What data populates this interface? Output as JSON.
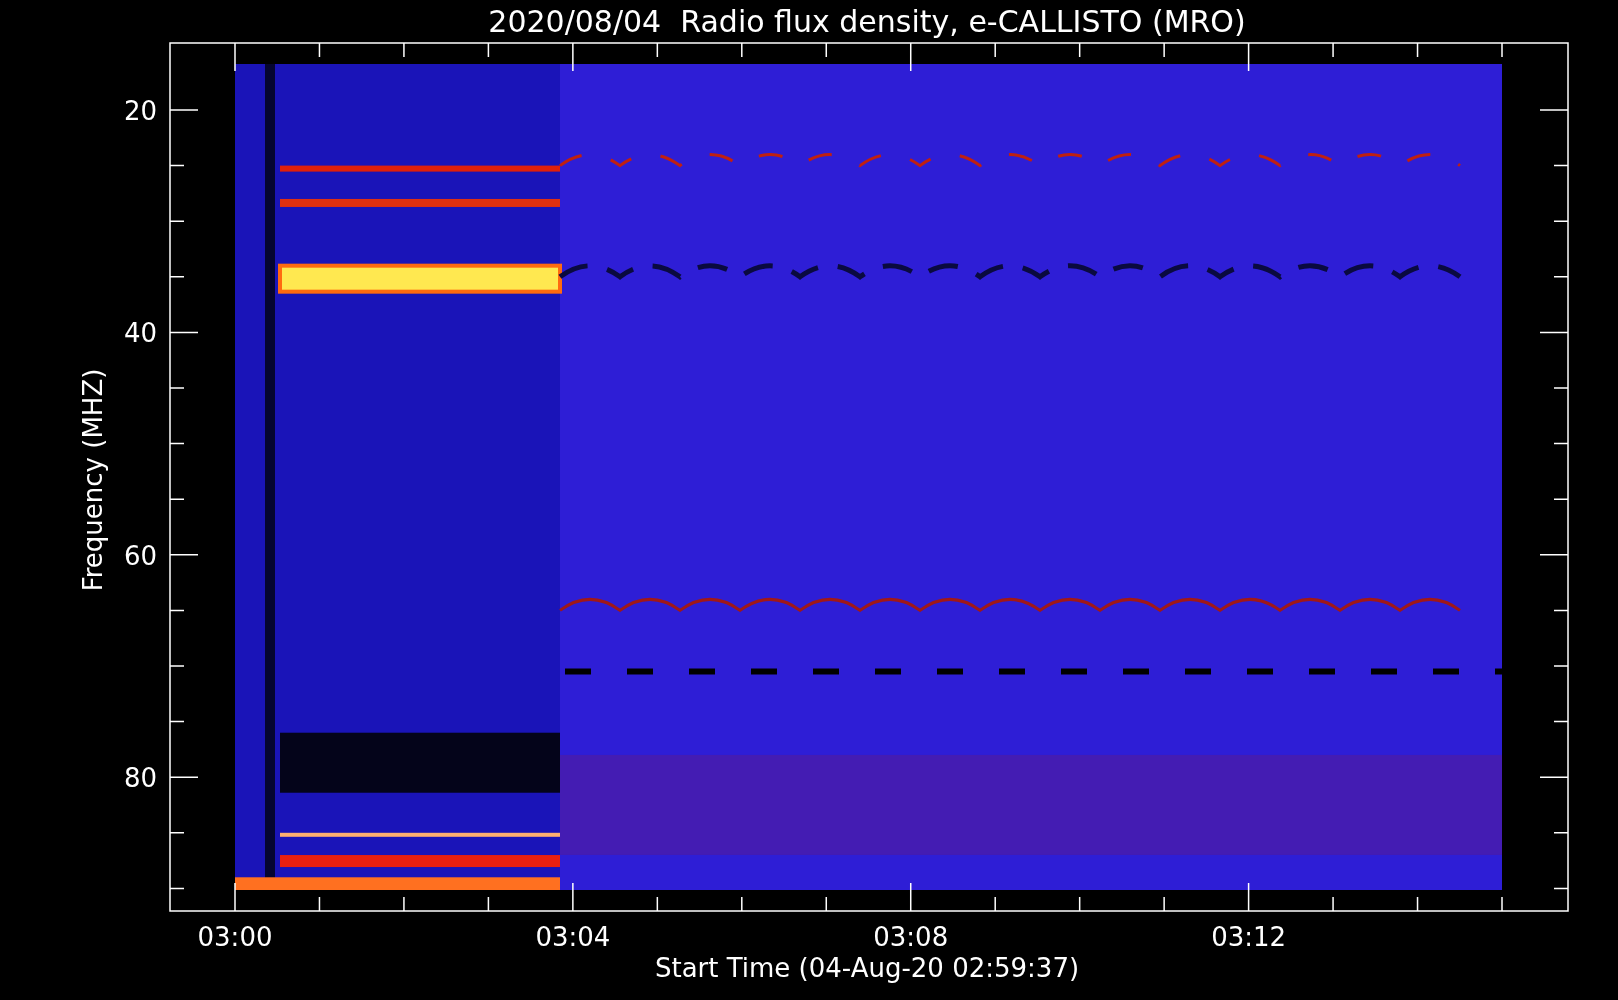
{
  "title": "2020/08/04  Radio flux density, e-CALLISTO (MRO)",
  "y_axis": {
    "label": "Frequency (MHZ)",
    "ticks": [
      "20",
      "40",
      "60",
      "80"
    ]
  },
  "x_axis": {
    "label": "Start Time (04-Aug-20 02:59:37)",
    "ticks": [
      "03:00",
      "03:04",
      "03:08",
      "03:12"
    ]
  }
}
